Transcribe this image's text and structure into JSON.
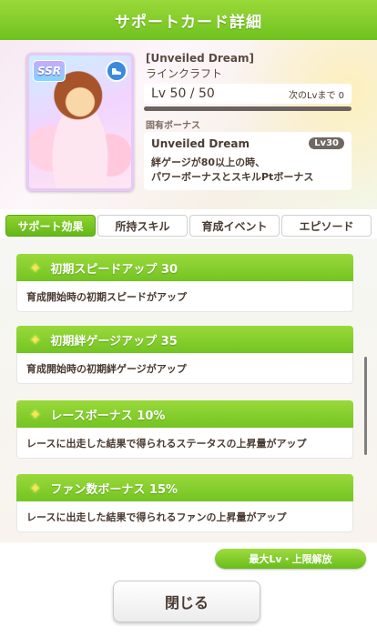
{
  "window": {
    "title": "サポートカード詳細"
  },
  "card": {
    "rarity": "SSR",
    "type_icon": "speed-type-icon",
    "name": "[Unveiled Dream]",
    "character": "ラインクラフト",
    "level_text": "Lv 50 / 50",
    "next_level_text": "次のLvまで 0",
    "level_progress": 1.0,
    "unique_bonus_label": "固有ボーナス",
    "unique_bonus_name": "Unveiled Dream",
    "unique_bonus_level": "Lv30",
    "unique_bonus_desc_1": "絆ゲージが80以上の時、",
    "unique_bonus_desc_2": "パワーボーナスとスキルPtボーナス"
  },
  "tabs": [
    {
      "label": "サポート効果",
      "active": true
    },
    {
      "label": "所持スキル",
      "active": false
    },
    {
      "label": "育成イベント",
      "active": false
    },
    {
      "label": "エピソード",
      "active": false
    }
  ],
  "effects": [
    {
      "title": "初期スピードアップ 30",
      "desc": "育成開始時の初期スピードがアップ"
    },
    {
      "title": "初期絆ゲージアップ 35",
      "desc": "育成開始時の初期絆ゲージがアップ"
    },
    {
      "title": "レースボーナス 10%",
      "desc": "レースに出走した結果で得られるステータスの上昇量がアップ"
    },
    {
      "title": "ファン数ボーナス 15%",
      "desc": "レースに出走した結果で得られるファンの上昇量がアップ"
    }
  ],
  "buttons": {
    "unlock_label": "最大Lv・上限解放",
    "close_label": "閉じる"
  },
  "colors": {
    "accent_green": "#7cc82a",
    "unlock_green": "#68bd1c"
  }
}
